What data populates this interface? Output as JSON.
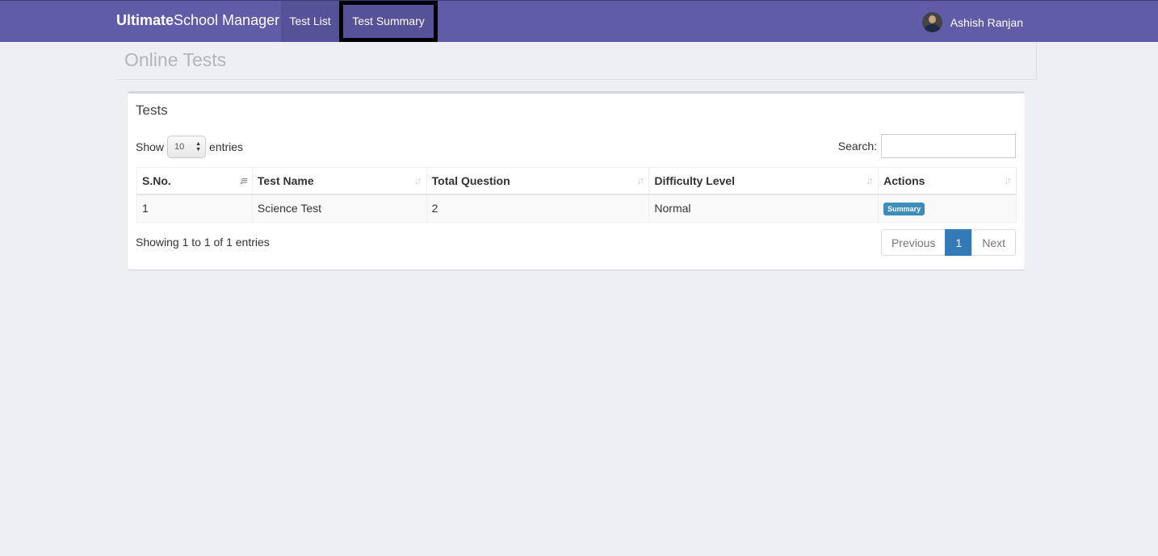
{
  "brand": {
    "bold": "Ultimate",
    "rest": "School Manager"
  },
  "nav": {
    "test_list": "Test List",
    "test_summary": "Test Summary"
  },
  "user": {
    "name": "Ashish Ranjan"
  },
  "page_title": "Online Tests",
  "box_title": "Tests",
  "length": {
    "show": "Show",
    "value": "10",
    "entries": "entries"
  },
  "search": {
    "label": "Search:",
    "value": ""
  },
  "table": {
    "headers": [
      "S.No.",
      "Test Name",
      "Total Question",
      "Difficulty Level",
      "Actions"
    ],
    "rows": [
      {
        "sno": "1",
        "name": "Science Test",
        "total": "2",
        "level": "Normal",
        "action": "Summary"
      }
    ]
  },
  "info": "Showing 1 to 1 of 1 entries",
  "pagination": {
    "previous": "Previous",
    "page": "1",
    "next": "Next"
  },
  "colors": {
    "navbar": "#605ca8",
    "summary_button": "#3c8dbc",
    "active_page": "#337ab7"
  }
}
